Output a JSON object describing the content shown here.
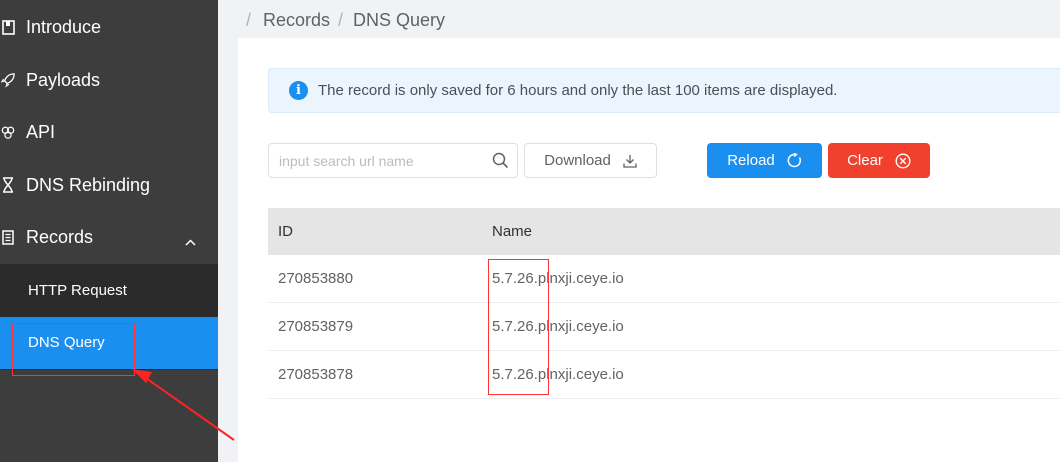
{
  "sidebar": {
    "items": [
      {
        "label": "Introduce",
        "icon": "book-icon"
      },
      {
        "label": "Payloads",
        "icon": "rocket-icon"
      },
      {
        "label": "API",
        "icon": "api-icon"
      },
      {
        "label": "DNS Rebinding",
        "icon": "hourglass-icon"
      },
      {
        "label": "Records",
        "icon": "list-icon",
        "expanded": true
      }
    ],
    "subitems": [
      {
        "label": "HTTP Request",
        "active": false
      },
      {
        "label": "DNS Query",
        "active": true
      }
    ]
  },
  "breadcrumb": {
    "separator": "/",
    "items": [
      "Records",
      "DNS Query"
    ]
  },
  "alert": {
    "icon": "info-icon",
    "text": "The record is only saved for 6 hours and only the last 100 items are displayed."
  },
  "toolbar": {
    "search_placeholder": "input search url name",
    "download_label": "Download",
    "reload_label": "Reload",
    "clear_label": "Clear"
  },
  "table": {
    "columns": [
      "ID",
      "Name"
    ],
    "rows": [
      {
        "id": "270853880",
        "name": "5.7.26.plnxji.ceye.io"
      },
      {
        "id": "270853879",
        "name": "5.7.26.plnxji.ceye.io"
      },
      {
        "id": "270853878",
        "name": "5.7.26.plnxji.ceye.io"
      }
    ]
  },
  "colors": {
    "sidebar_bg": "#3d3d3d",
    "active": "#1b8ff0",
    "danger": "#f2402f",
    "annotation": "#ff3333"
  }
}
